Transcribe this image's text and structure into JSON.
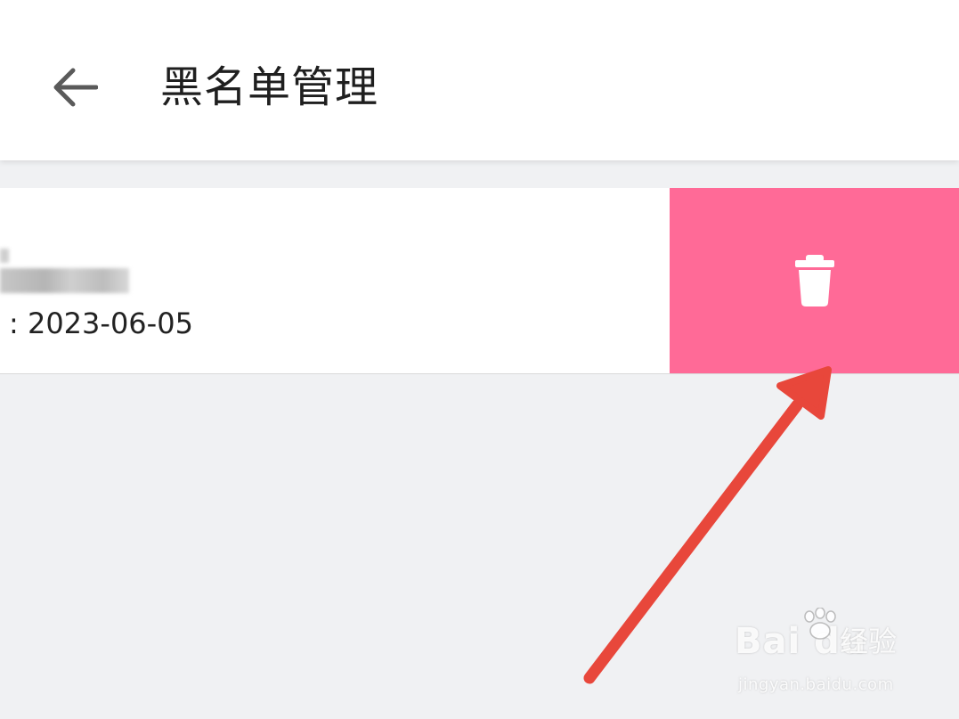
{
  "header": {
    "title": "黑名单管理",
    "back_icon": "arrow-left-icon"
  },
  "blacklist": {
    "items": [
      {
        "name": "",
        "date_text": ": 2023-06-05",
        "delete_icon": "trash-icon",
        "delete_color": "#ff6a97"
      }
    ]
  },
  "annotation": {
    "arrow_color": "#e8473b"
  },
  "watermark": {
    "logo_text": "Bai du",
    "suffix_text": "经验",
    "url_text": "jingyan.baidu.com"
  },
  "colors": {
    "header_bg": "#ffffff",
    "page_bg": "#f0f1f3",
    "delete_bg": "#ff6a97"
  }
}
